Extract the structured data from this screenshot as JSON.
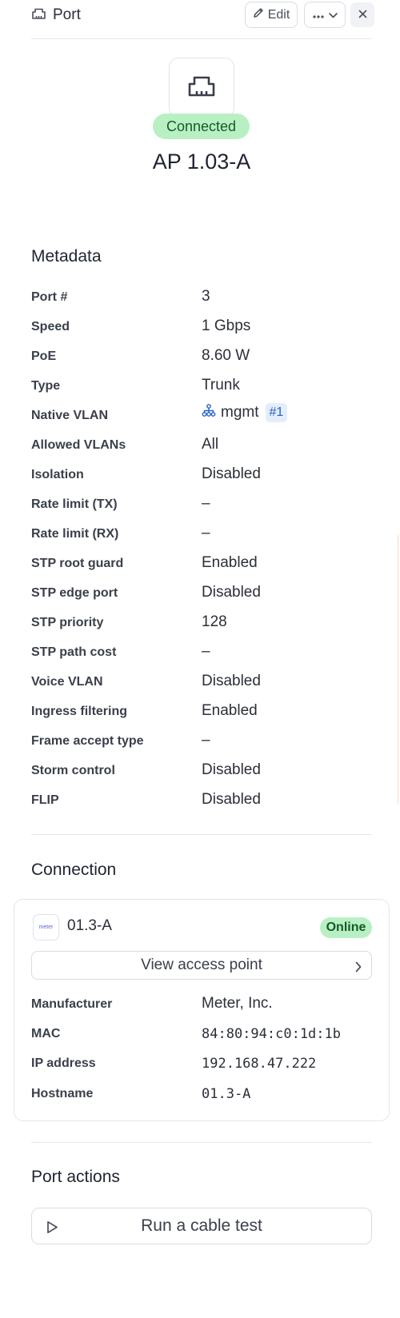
{
  "header": {
    "title": "Port",
    "edit_label": "Edit",
    "icons": {
      "port": "ethernet-port-icon",
      "edit": "pencil-icon",
      "more": "ellipsis-icon",
      "chevron": "chevron-down-icon",
      "close": "close-icon"
    }
  },
  "hero": {
    "status": "Connected",
    "name": "AP 1.03-A",
    "icon": "ethernet-port-icon"
  },
  "metadata": {
    "heading": "Metadata",
    "rows": [
      {
        "label": "Port #",
        "value": "3"
      },
      {
        "label": "Speed",
        "value": "1 Gbps"
      },
      {
        "label": "PoE",
        "value": "8.60 W"
      },
      {
        "label": "Type",
        "value": "Trunk"
      },
      {
        "label": "Native VLAN",
        "value": "mgmt",
        "badge": "#1"
      },
      {
        "label": "Allowed VLANs",
        "value": "All"
      },
      {
        "label": "Isolation",
        "value": "Disabled"
      },
      {
        "label": "Rate limit (TX)",
        "value": "–"
      },
      {
        "label": "Rate limit (RX)",
        "value": "–"
      },
      {
        "label": "STP root guard",
        "value": "Enabled"
      },
      {
        "label": "STP edge port",
        "value": "Disabled"
      },
      {
        "label": "STP priority",
        "value": "128"
      },
      {
        "label": "STP path cost",
        "value": "–"
      },
      {
        "label": "Voice VLAN",
        "value": "Disabled"
      },
      {
        "label": "Ingress filtering",
        "value": "Enabled"
      },
      {
        "label": "Frame accept type",
        "value": "–"
      },
      {
        "label": "Storm control",
        "value": "Disabled"
      },
      {
        "label": "FLIP",
        "value": "Disabled"
      }
    ]
  },
  "connection": {
    "heading": "Connection",
    "device_name": "01.3-A",
    "device_thumb_text": "meter",
    "status": "Online",
    "view_label": "View access point",
    "rows": [
      {
        "label": "Manufacturer",
        "value": "Meter, Inc."
      },
      {
        "label": "MAC",
        "value": "84:80:94:c0:1d:1b"
      },
      {
        "label": "IP address",
        "value": "192.168.47.222"
      },
      {
        "label": "Hostname",
        "value": "01.3-A"
      }
    ]
  },
  "port_actions": {
    "heading": "Port actions",
    "cable_test_label": "Run a cable test"
  },
  "colors": {
    "success_bg": "#b8f0c4",
    "success_text": "#145a28",
    "link": "#2461c9"
  }
}
